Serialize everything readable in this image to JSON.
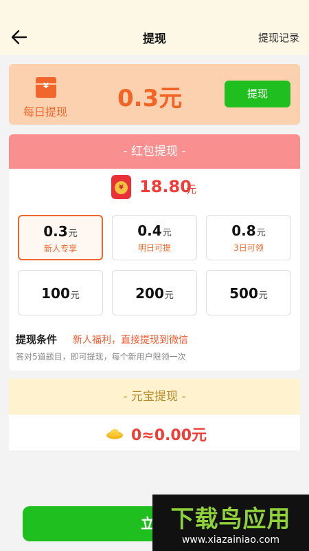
{
  "header": {
    "title": "提现",
    "right_link": "提现记录"
  },
  "daily": {
    "label": "每日提现",
    "amount": "0.3元",
    "button": "提现",
    "icon": "red-envelope-icon"
  },
  "redpack": {
    "header": "- 红包提现 -",
    "balance": "18.80",
    "balance_unit": "元",
    "amounts": [
      {
        "value": "0.3",
        "unit": "元",
        "note": "新人专享",
        "selected": true
      },
      {
        "value": "0.4",
        "unit": "元",
        "note": "明日可提",
        "selected": false
      },
      {
        "value": "0.8",
        "unit": "元",
        "note": "3日可领",
        "selected": false
      },
      {
        "value": "100",
        "unit": "元",
        "note": "",
        "selected": false
      },
      {
        "value": "200",
        "unit": "元",
        "note": "",
        "selected": false
      },
      {
        "value": "500",
        "unit": "元",
        "note": "",
        "selected": false
      }
    ],
    "condition_title": "提现条件",
    "condition_highlight": "新人福利，直接提现到微信",
    "condition_desc": "答对5道题目，即可提现，每个新用户限领一次"
  },
  "ingot": {
    "header": "- 元宝提现 -",
    "value": "0≈0.00元",
    "icon": "gold-ingot-icon"
  },
  "bottom_button": "立即",
  "watermark": {
    "brand": "下载鸟应用",
    "url": "www.xiazainiao.com"
  },
  "colors": {
    "accent": "#f26425",
    "green": "#1fbf1f",
    "red": "#ef3e38",
    "pink_header": "#fa8f8f",
    "cream_header": "#fff2cf"
  }
}
